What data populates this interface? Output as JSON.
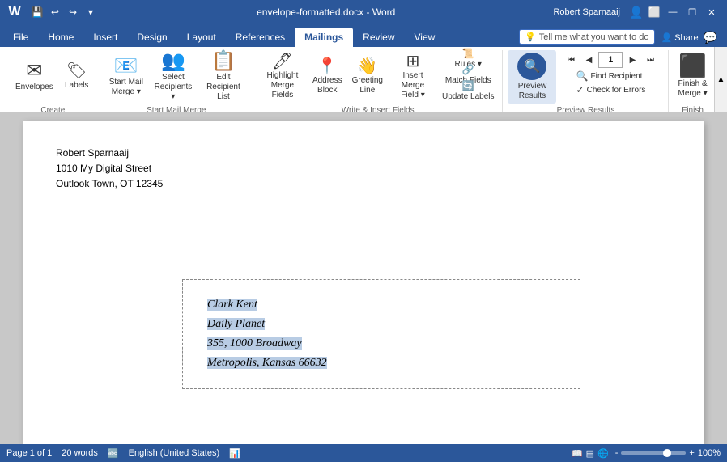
{
  "titleBar": {
    "filename": "envelope-formatted.docx",
    "app": "Word",
    "fullTitle": "envelope-formatted.docx - Word",
    "user": "Robert Sparnaaij",
    "minimizeLabel": "—",
    "restoreLabel": "❐",
    "closeLabel": "✕",
    "undoLabel": "↩",
    "redoLabel": "↪"
  },
  "tabs": [
    {
      "label": "File",
      "active": false
    },
    {
      "label": "Home",
      "active": false
    },
    {
      "label": "Insert",
      "active": false
    },
    {
      "label": "Design",
      "active": false
    },
    {
      "label": "Layout",
      "active": false
    },
    {
      "label": "References",
      "active": false
    },
    {
      "label": "Mailings",
      "active": true
    },
    {
      "label": "Review",
      "active": false
    },
    {
      "label": "View",
      "active": false
    }
  ],
  "ribbon": {
    "groups": [
      {
        "name": "Create",
        "label": "Create",
        "buttons": [
          {
            "id": "envelopes",
            "label": "Envelopes",
            "icon": "✉"
          },
          {
            "id": "labels",
            "label": "Labels",
            "icon": "🏷"
          }
        ]
      },
      {
        "name": "StartMailMerge",
        "label": "Start Mail Merge",
        "buttons": [
          {
            "id": "start-mail-merge",
            "label": "Start Mail Merge",
            "icon": "📧"
          },
          {
            "id": "select-recipients",
            "label": "Select Recipients",
            "icon": "👥"
          },
          {
            "id": "edit-recipient-list",
            "label": "Edit Recipient List",
            "icon": "📋"
          }
        ]
      },
      {
        "name": "WriteInsertFields",
        "label": "Write & Insert Fields",
        "buttons": [
          {
            "id": "highlight-merge-fields",
            "label": "Highlight Merge Fields",
            "icon": "🖊"
          },
          {
            "id": "address-block",
            "label": "Address Block",
            "icon": "📍"
          },
          {
            "id": "greeting-line",
            "label": "Greeting Line",
            "icon": "👋"
          },
          {
            "id": "insert-merge-field",
            "label": "Insert Merge Field",
            "icon": "⊞"
          },
          {
            "id": "rules",
            "label": "Rules ▾",
            "icon": "📜",
            "small": true
          },
          {
            "id": "match-fields",
            "label": "Match Fields",
            "icon": "🔗",
            "small": true
          },
          {
            "id": "update-labels",
            "label": "Update Labels",
            "icon": "🔄",
            "small": true
          }
        ]
      },
      {
        "name": "PreviewResults",
        "label": "Preview Results",
        "buttons": [
          {
            "id": "preview-results",
            "label": "Preview Results",
            "icon": "🔍",
            "active": true
          },
          {
            "id": "find-recipient",
            "label": "Find Recipient",
            "icon": "🔍",
            "small": true
          },
          {
            "id": "check-for-errors",
            "label": "Check for Errors",
            "icon": "✓",
            "small": true
          }
        ],
        "navigation": {
          "first": "⏮",
          "prev": "◀",
          "current": "1",
          "next": "▶",
          "last": "⏭"
        }
      },
      {
        "name": "Finish",
        "label": "Finish",
        "buttons": [
          {
            "id": "finish-merge",
            "label": "Finish & Merge",
            "icon": "✅"
          }
        ]
      }
    ]
  },
  "tellMe": {
    "placeholder": "Tell me what you want to do",
    "icon": "💡"
  },
  "share": {
    "label": "Share",
    "icon": "👤"
  },
  "document": {
    "returnAddress": {
      "line1": "Robert Sparnaaij",
      "line2": "1010 My Digital Street",
      "line3": "Outlook Town, OT 12345"
    },
    "deliveryAddress": {
      "line1": "Clark Kent",
      "line2": "Daily Planet",
      "line3": "355, 1000 Broadway",
      "line4": "Metropolis, Kansas 66632"
    }
  },
  "statusBar": {
    "page": "Page 1 of 1",
    "words": "20 words",
    "language": "English (United States)",
    "zoom": "100%",
    "viewNormal": "▤",
    "viewWeb": "🌐",
    "viewRead": "📖",
    "zoomOut": "-",
    "zoomIn": "+"
  }
}
